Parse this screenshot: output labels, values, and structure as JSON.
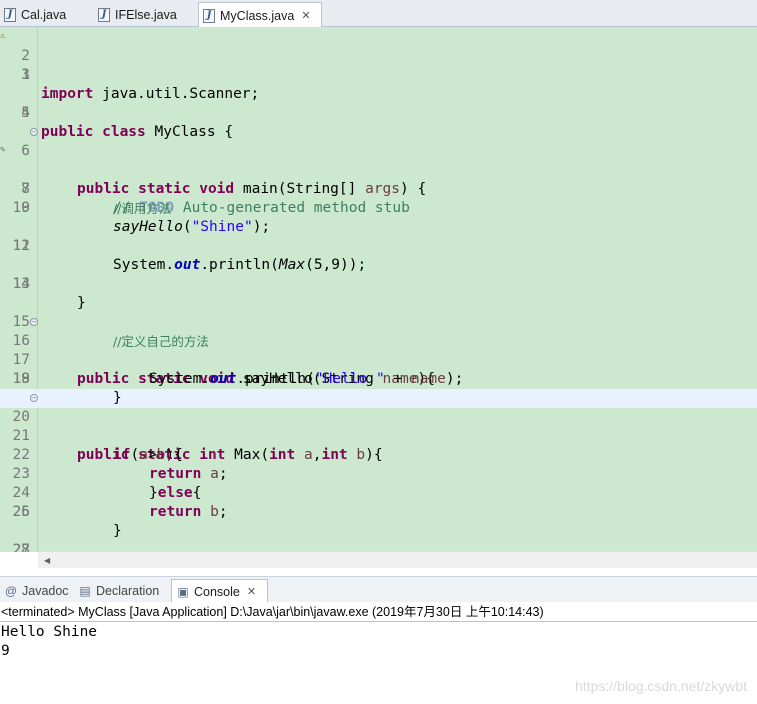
{
  "editor_tabs": [
    {
      "label": "Cal.java",
      "active": false
    },
    {
      "label": "IFElse.java",
      "active": false
    },
    {
      "label": "MyClass.java",
      "active": true,
      "close": "✕"
    }
  ],
  "code": {
    "l1_kw": "import",
    "l1_rest": " java.util.Scanner;",
    "l4_kw": "public class",
    "l4_rest": " MyClass {",
    "l6_kw": "public static void",
    "l6_a": " main(String[] ",
    "l6_prm": "args",
    "l6_b": ") {",
    "l7_a": "// ",
    "l7_todo": "TODO",
    "l7_b": " Auto-generated method stub",
    "l8": "//调用方法",
    "l9_it": "sayHello",
    "l9_a": "(",
    "l9_str": "\"Shine\"",
    "l9_b": ");",
    "l11_a": "System.",
    "l11_fld": "out",
    "l11_b": ".println(",
    "l11_it": "Max",
    "l11_c": "(5,9));",
    "l13": "}",
    "l15": "//定义自己的方法",
    "l16_kw": "public static void",
    "l16_a": " sayHello(String ",
    "l16_prm": "name",
    "l16_b": "){",
    "l17_a": "System.",
    "l17_fld": "out",
    "l17_b": ".println(",
    "l17_str": "\"Hello \"",
    "l17_c": " + ",
    "l17_prm": "name",
    "l17_d": ");",
    "l18": "}",
    "l20_kw": "public static int",
    "l20_a": " Max(",
    "l20_kw2": "int",
    "l20_sp": " ",
    "l20_prm": "a",
    "l20_c": ",",
    "l20_kw3": "int",
    "l20_sp2": " ",
    "l20_prm2": "b",
    "l20_d": "){",
    "l21_kw": "if",
    "l21_a": "(",
    "l21_prm": "a",
    "l21_b": ">",
    "l21_prm2": "b",
    "l21_c": "){",
    "l22_kw": "return",
    "l22_sp": " ",
    "l22_prm": "a",
    "l22_a": ";",
    "l23_a": "}",
    "l23_kw": "else",
    "l23_b": "{",
    "l24_kw": "return",
    "l24_sp": " ",
    "l24_prm": "b",
    "l24_a": ";",
    "l25": "}",
    "l27": "}"
  },
  "line_numbers": [
    "1",
    "2",
    "3",
    "4",
    "5",
    "6",
    "7",
    "8",
    "9",
    "10",
    "11",
    "12",
    "13",
    "14",
    "15",
    "16",
    "17",
    "18",
    "19",
    "20",
    "21",
    "22",
    "23",
    "24",
    "25",
    "26",
    "27",
    "28"
  ],
  "view_tabs": [
    {
      "label": "Javadoc",
      "icon": "at-icon"
    },
    {
      "label": "Declaration",
      "icon": "declaration-icon"
    },
    {
      "label": "Console",
      "icon": "console-icon",
      "close": "✕"
    }
  ],
  "console": {
    "header": "<terminated> MyClass [Java Application] D:\\Java\\jar\\bin\\javaw.exe (2019年7月30日 上午10:14:43)",
    "output": [
      "Hello Shine",
      "9"
    ]
  },
  "watermark": "https://blog.csdn.net/zkywbt",
  "colors": {
    "editor_bg": "#cce8cf",
    "current_line": "#e8f2fe",
    "keyword": "#7f0055",
    "string": "#2a00ff",
    "comment": "#3f7f5f",
    "field": "#0000c0"
  }
}
